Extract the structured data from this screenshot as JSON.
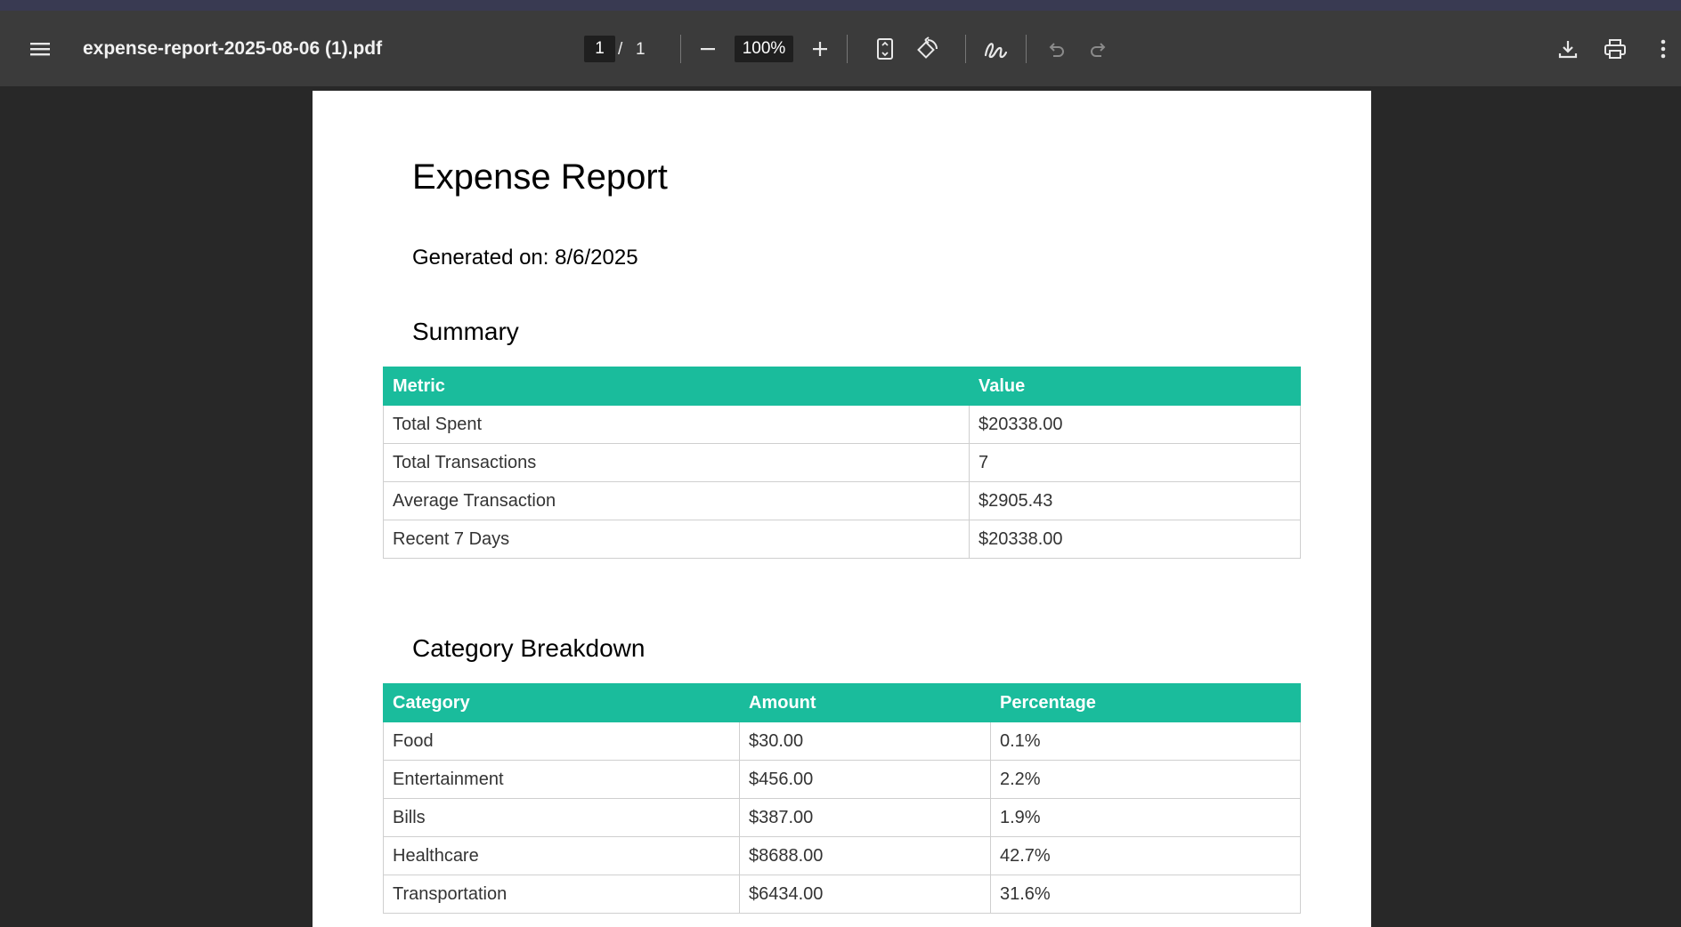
{
  "viewer": {
    "filename": "expense-report-2025-08-06 (1).pdf",
    "current_page": "1",
    "page_separator": "/",
    "total_pages": "1",
    "zoom": "100%"
  },
  "icons": {
    "menu": "hamburger-menu-icon",
    "zoom_out": "minus-icon",
    "zoom_in": "plus-icon",
    "fit": "fit-to-page-icon",
    "rotate": "rotate-icon",
    "draw": "annotate-pen-icon",
    "undo": "undo-icon",
    "redo": "redo-icon",
    "download": "download-icon",
    "print": "print-icon",
    "more": "more-vertical-icon"
  },
  "colors": {
    "table_header": "#1abc9c",
    "toolbar": "#3b3b3b",
    "background": "#282828"
  },
  "report": {
    "title": "Expense Report",
    "generated": "Generated on: 8/6/2025",
    "summary": {
      "heading": "Summary",
      "headers": [
        "Metric",
        "Value"
      ],
      "rows": [
        [
          "Total Spent",
          "$20338.00"
        ],
        [
          "Total Transactions",
          "7"
        ],
        [
          "Average Transaction",
          "$2905.43"
        ],
        [
          "Recent 7 Days",
          "$20338.00"
        ]
      ]
    },
    "categories": {
      "heading": "Category Breakdown",
      "headers": [
        "Category",
        "Amount",
        "Percentage"
      ],
      "rows": [
        [
          "Food",
          "$30.00",
          "0.1%"
        ],
        [
          "Entertainment",
          "$456.00",
          "2.2%"
        ],
        [
          "Bills",
          "$387.00",
          "1.9%"
        ],
        [
          "Healthcare",
          "$8688.00",
          "42.7%"
        ],
        [
          "Transportation",
          "$6434.00",
          "31.6%"
        ]
      ]
    }
  }
}
